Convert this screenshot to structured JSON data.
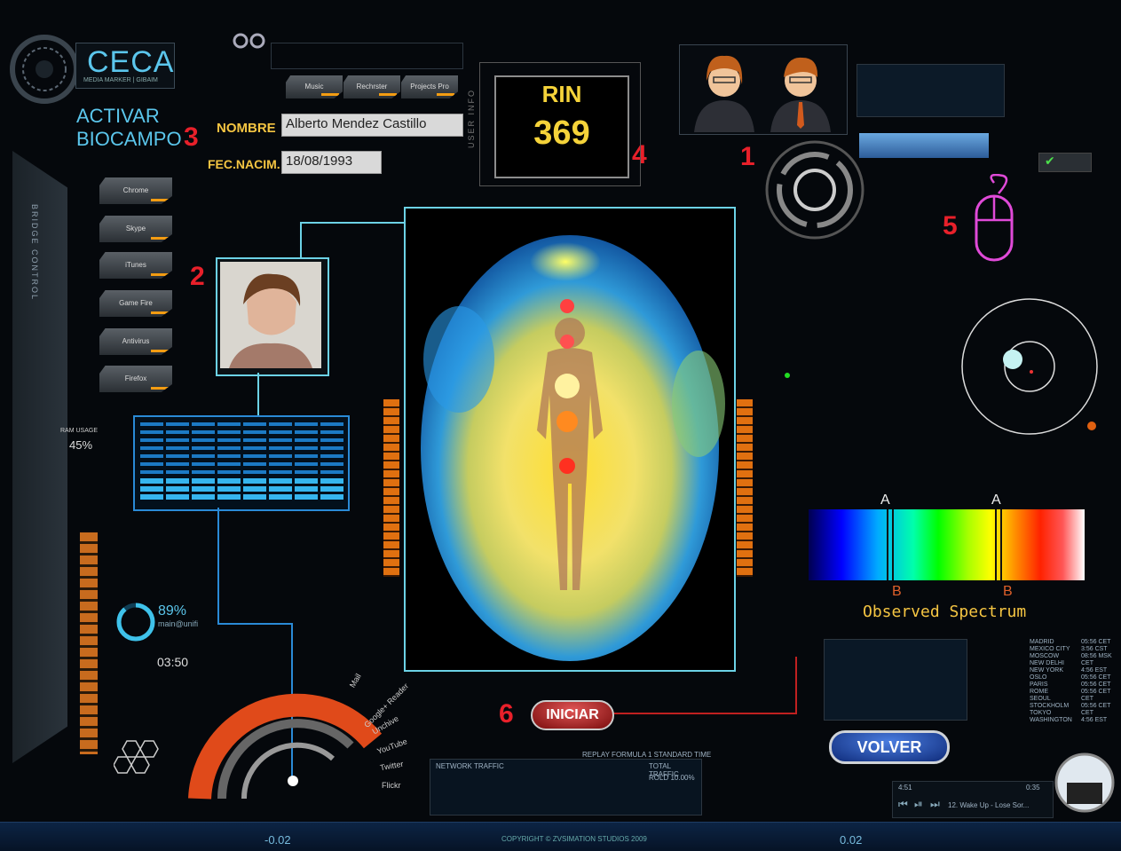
{
  "logo": {
    "title": "CECA",
    "subtitle": "MEDIA MARKER | GIBAIM"
  },
  "activar": {
    "line1": "ACTIVAR",
    "line2": "BIOCAMPO"
  },
  "markers": [
    "1",
    "2",
    "3",
    "4",
    "5",
    "6"
  ],
  "form": {
    "name_label": "NOMBRE",
    "name_value": "Alberto Mendez Castillo",
    "dob_label": "FEC.NACIM.",
    "dob_value": "18/08/1993"
  },
  "side_menu": [
    "Chrome",
    "Skype",
    "iTunes",
    "Game Fire",
    "Antivirus",
    "Firefox"
  ],
  "top_tabs": [
    "Music",
    "Rechrster",
    "Projects Pro"
  ],
  "rin": {
    "title": "RIN",
    "value": "369",
    "side_label": "USER INFO"
  },
  "ram": {
    "label": "RAM USAGE",
    "value": "45%"
  },
  "gauge": {
    "percent": "89%",
    "caption": "main@unifi",
    "time": "03:50"
  },
  "spectrum": {
    "letter_a": "A",
    "letter_b": "B",
    "caption": "Observed Spectrum"
  },
  "buttons": {
    "start": "INICIAR",
    "back": "VOLVER"
  },
  "apps_arc": [
    "Mail",
    "Google+ Reader",
    "Unchive",
    "YouTube",
    "Twitter",
    "Flickr"
  ],
  "world_clock": [
    {
      "city": "MADRID",
      "time": "05:56 CET"
    },
    {
      "city": "MEXICO CITY",
      "time": "3:56 CST"
    },
    {
      "city": "MOSCOW",
      "time": "08:56 MSK"
    },
    {
      "city": "NEW DELHI",
      "time": "CET"
    },
    {
      "city": "NEW YORK",
      "time": "4:56 EST"
    },
    {
      "city": "OSLO",
      "time": "05:56 CET"
    },
    {
      "city": "PARIS",
      "time": "05:56 CET"
    },
    {
      "city": "ROME",
      "time": "05:56 CET"
    },
    {
      "city": "SEOUL",
      "time": "CET"
    },
    {
      "city": "STOCKHOLM",
      "time": "05:56 CET"
    },
    {
      "city": "TOKYO",
      "time": "CET"
    },
    {
      "city": "WASHINGTON",
      "time": "4:56 EST"
    }
  ],
  "footer": {
    "copyright": "COPYRIGHT © ZVSIMATION STUDIOS 2009",
    "left_value": "-0.02",
    "right_value": "0.02"
  },
  "music": {
    "time": "4:51",
    "track": "12. Wake Up - Lose Sor...",
    "end": "0:35"
  },
  "traffic": {
    "title": "REPLAY FORMULA 1 STANDARD TIME",
    "label": "NETWORK TRAFFIC",
    "total": "TOTAL TRAFFIC",
    "total2": "ROLD 10.00%"
  },
  "sidebar_text": "BRIDGE CONTROL",
  "colors": {
    "accent": "#5bc6ec",
    "marker": "#e8202a",
    "rin": "#f5d33a"
  }
}
